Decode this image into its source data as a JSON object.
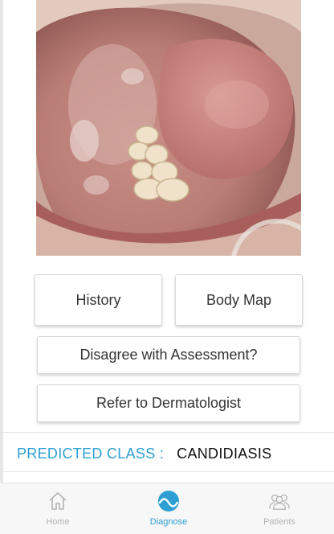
{
  "buttons": {
    "history": "History",
    "body_map": "Body Map",
    "disagree": "Disagree with Assessment?",
    "refer": "Refer to Dermatologist"
  },
  "prediction": {
    "label": "PREDICTED CLASS :",
    "value": "CANDIDIASIS",
    "label_color": "#2d9fd3"
  },
  "tabs": [
    {
      "label": "Home",
      "icon": "home-icon",
      "active": false
    },
    {
      "label": "Diagnose",
      "icon": "diagnose-icon",
      "active": true
    },
    {
      "label": "Patients",
      "icon": "patients-icon",
      "active": false
    }
  ],
  "colors": {
    "accent": "#2d9fd3",
    "inactive": "#b3b3b3"
  }
}
